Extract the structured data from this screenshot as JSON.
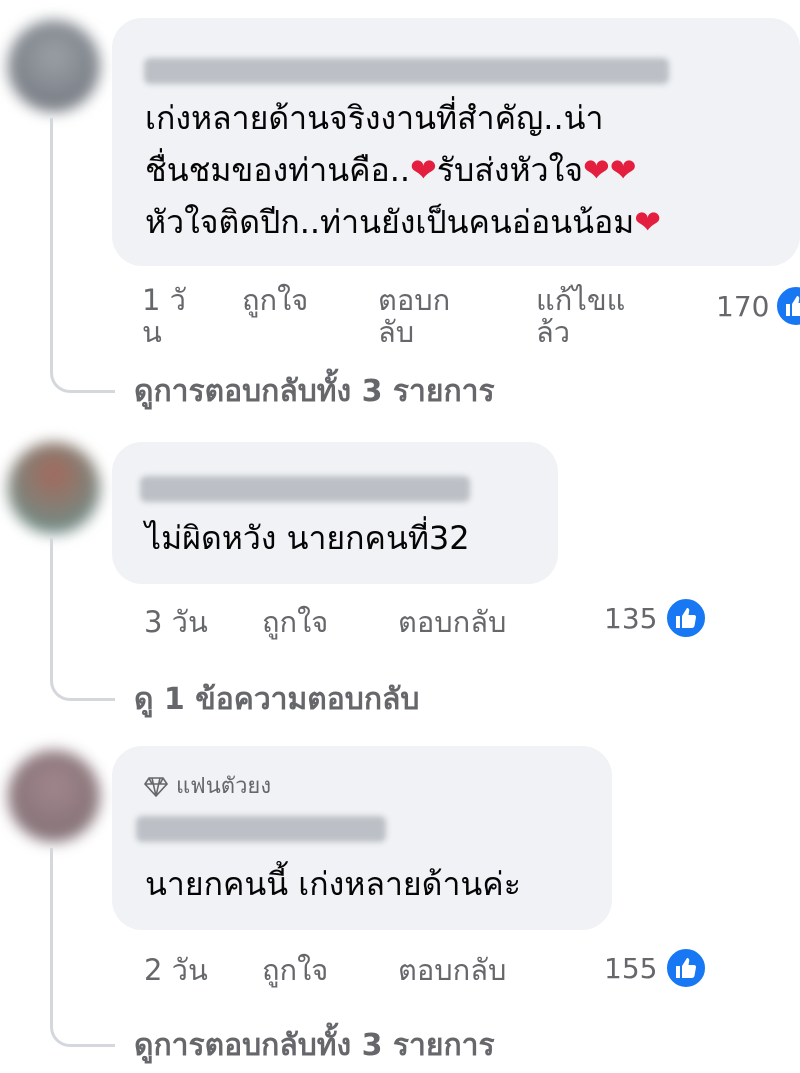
{
  "comments": [
    {
      "text_lines": [
        "เก่งหลายด้านจริงงานที่สำคัญ..น่า",
        "ชื่นชมของท่านคือ..",
        "หัวใจติดปีก..ท่านยังเป็นคนอ่อนน้อม"
      ],
      "line2_suffix": "รับส่งหัวใจ",
      "time": "1 วัน",
      "like_label": "ถูกใจ",
      "reply_label": "ตอบกลับ",
      "edited_label": "แก้ไขแล้ว",
      "reactions": "170",
      "view_replies": "ดูการตอบกลับทั้ง 3 รายการ"
    },
    {
      "text": "ไม่ผิดหวัง นายกคนที่32",
      "time": "3 วัน",
      "like_label": "ถูกใจ",
      "reply_label": "ตอบกลับ",
      "reactions": "135",
      "view_replies": "ดู 1 ข้อความตอบกลับ"
    },
    {
      "badge": "แฟนตัวยง",
      "text": "นายกคนนี้ เก่งหลายด้านค่ะ",
      "time": "2 วัน",
      "like_label": "ถูกใจ",
      "reply_label": "ตอบกลับ",
      "reactions": "155",
      "view_replies": "ดูการตอบกลับทั้ง 3 รายการ"
    }
  ],
  "colors": {
    "bubble": "#f0f2f5",
    "meta": "#65676b",
    "like_blue": "#1877f2",
    "heart": "#e41e3f"
  }
}
